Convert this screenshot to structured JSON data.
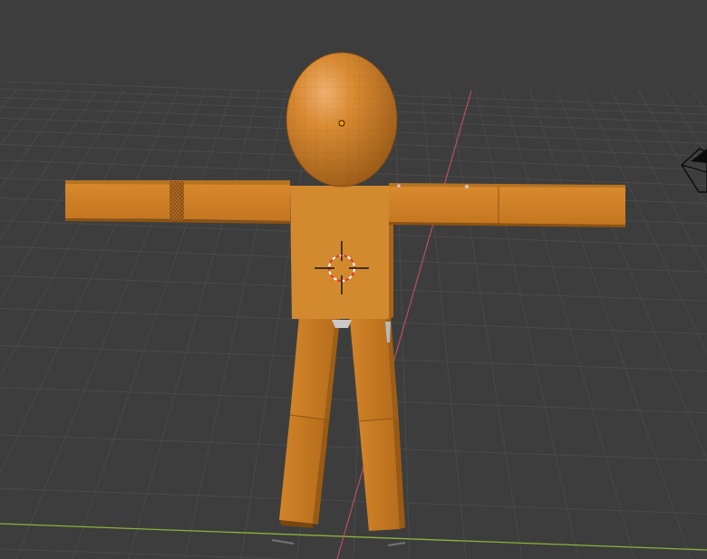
{
  "viewport": {
    "background_color": "#3d3d3d",
    "grid_color": "#4a4a4a",
    "x_axis_color": "#8cb23a",
    "y_axis_color": "#b8505c",
    "model_color": "#d98828",
    "model_shadow_color": "#a86318"
  },
  "scene": {
    "object": "t-pose-figure",
    "icons": [
      "3d-cursor-icon",
      "object-origin-icon",
      "camera-icon"
    ]
  }
}
